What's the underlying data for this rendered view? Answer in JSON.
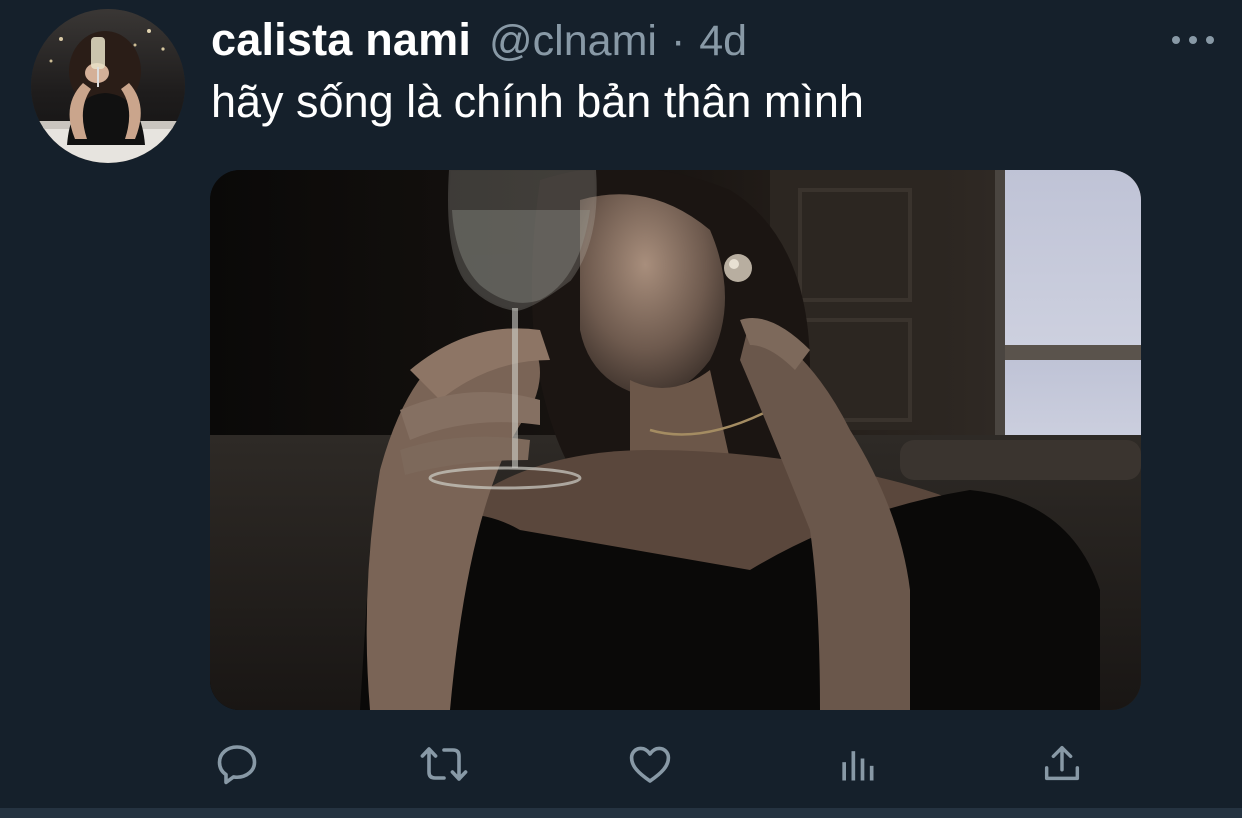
{
  "tweet": {
    "display_name": "calista nami",
    "handle": "@clnami",
    "separator": "·",
    "timestamp": "4d",
    "text": "hãy sống là chính bản thân mình",
    "avatar_icon": "user-avatar-photo",
    "media_icon": "attached-photo"
  },
  "actions": {
    "reply_icon": "reply-icon",
    "retweet_icon": "retweet-icon",
    "like_icon": "heart-icon",
    "analytics_icon": "analytics-icon",
    "share_icon": "share-icon",
    "more_icon": "more-options-icon"
  },
  "colors": {
    "background": "#15202b",
    "text_primary": "#ffffff",
    "text_secondary": "#8899a6",
    "icon": "#8899a6"
  }
}
